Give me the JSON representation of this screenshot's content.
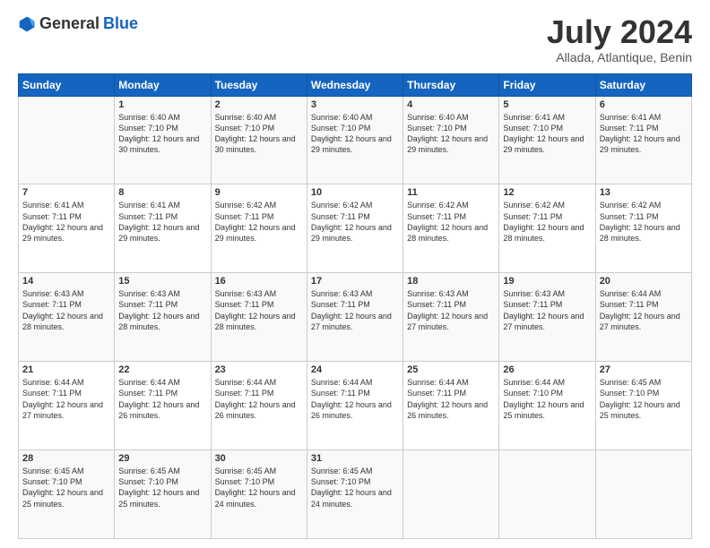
{
  "header": {
    "logo_general": "General",
    "logo_blue": "Blue",
    "month_year": "July 2024",
    "location": "Allada, Atlantique, Benin"
  },
  "weekdays": [
    "Sunday",
    "Monday",
    "Tuesday",
    "Wednesday",
    "Thursday",
    "Friday",
    "Saturday"
  ],
  "weeks": [
    [
      {
        "day": "",
        "sunrise": "",
        "sunset": "",
        "daylight": ""
      },
      {
        "day": "1",
        "sunrise": "Sunrise: 6:40 AM",
        "sunset": "Sunset: 7:10 PM",
        "daylight": "Daylight: 12 hours and 30 minutes."
      },
      {
        "day": "2",
        "sunrise": "Sunrise: 6:40 AM",
        "sunset": "Sunset: 7:10 PM",
        "daylight": "Daylight: 12 hours and 30 minutes."
      },
      {
        "day": "3",
        "sunrise": "Sunrise: 6:40 AM",
        "sunset": "Sunset: 7:10 PM",
        "daylight": "Daylight: 12 hours and 29 minutes."
      },
      {
        "day": "4",
        "sunrise": "Sunrise: 6:40 AM",
        "sunset": "Sunset: 7:10 PM",
        "daylight": "Daylight: 12 hours and 29 minutes."
      },
      {
        "day": "5",
        "sunrise": "Sunrise: 6:41 AM",
        "sunset": "Sunset: 7:10 PM",
        "daylight": "Daylight: 12 hours and 29 minutes."
      },
      {
        "day": "6",
        "sunrise": "Sunrise: 6:41 AM",
        "sunset": "Sunset: 7:11 PM",
        "daylight": "Daylight: 12 hours and 29 minutes."
      }
    ],
    [
      {
        "day": "7",
        "sunrise": "Sunrise: 6:41 AM",
        "sunset": "Sunset: 7:11 PM",
        "daylight": "Daylight: 12 hours and 29 minutes."
      },
      {
        "day": "8",
        "sunrise": "Sunrise: 6:41 AM",
        "sunset": "Sunset: 7:11 PM",
        "daylight": "Daylight: 12 hours and 29 minutes."
      },
      {
        "day": "9",
        "sunrise": "Sunrise: 6:42 AM",
        "sunset": "Sunset: 7:11 PM",
        "daylight": "Daylight: 12 hours and 29 minutes."
      },
      {
        "day": "10",
        "sunrise": "Sunrise: 6:42 AM",
        "sunset": "Sunset: 7:11 PM",
        "daylight": "Daylight: 12 hours and 29 minutes."
      },
      {
        "day": "11",
        "sunrise": "Sunrise: 6:42 AM",
        "sunset": "Sunset: 7:11 PM",
        "daylight": "Daylight: 12 hours and 28 minutes."
      },
      {
        "day": "12",
        "sunrise": "Sunrise: 6:42 AM",
        "sunset": "Sunset: 7:11 PM",
        "daylight": "Daylight: 12 hours and 28 minutes."
      },
      {
        "day": "13",
        "sunrise": "Sunrise: 6:42 AM",
        "sunset": "Sunset: 7:11 PM",
        "daylight": "Daylight: 12 hours and 28 minutes."
      }
    ],
    [
      {
        "day": "14",
        "sunrise": "Sunrise: 6:43 AM",
        "sunset": "Sunset: 7:11 PM",
        "daylight": "Daylight: 12 hours and 28 minutes."
      },
      {
        "day": "15",
        "sunrise": "Sunrise: 6:43 AM",
        "sunset": "Sunset: 7:11 PM",
        "daylight": "Daylight: 12 hours and 28 minutes."
      },
      {
        "day": "16",
        "sunrise": "Sunrise: 6:43 AM",
        "sunset": "Sunset: 7:11 PM",
        "daylight": "Daylight: 12 hours and 28 minutes."
      },
      {
        "day": "17",
        "sunrise": "Sunrise: 6:43 AM",
        "sunset": "Sunset: 7:11 PM",
        "daylight": "Daylight: 12 hours and 27 minutes."
      },
      {
        "day": "18",
        "sunrise": "Sunrise: 6:43 AM",
        "sunset": "Sunset: 7:11 PM",
        "daylight": "Daylight: 12 hours and 27 minutes."
      },
      {
        "day": "19",
        "sunrise": "Sunrise: 6:43 AM",
        "sunset": "Sunset: 7:11 PM",
        "daylight": "Daylight: 12 hours and 27 minutes."
      },
      {
        "day": "20",
        "sunrise": "Sunrise: 6:44 AM",
        "sunset": "Sunset: 7:11 PM",
        "daylight": "Daylight: 12 hours and 27 minutes."
      }
    ],
    [
      {
        "day": "21",
        "sunrise": "Sunrise: 6:44 AM",
        "sunset": "Sunset: 7:11 PM",
        "daylight": "Daylight: 12 hours and 27 minutes."
      },
      {
        "day": "22",
        "sunrise": "Sunrise: 6:44 AM",
        "sunset": "Sunset: 7:11 PM",
        "daylight": "Daylight: 12 hours and 26 minutes."
      },
      {
        "day": "23",
        "sunrise": "Sunrise: 6:44 AM",
        "sunset": "Sunset: 7:11 PM",
        "daylight": "Daylight: 12 hours and 26 minutes."
      },
      {
        "day": "24",
        "sunrise": "Sunrise: 6:44 AM",
        "sunset": "Sunset: 7:11 PM",
        "daylight": "Daylight: 12 hours and 26 minutes."
      },
      {
        "day": "25",
        "sunrise": "Sunrise: 6:44 AM",
        "sunset": "Sunset: 7:11 PM",
        "daylight": "Daylight: 12 hours and 26 minutes."
      },
      {
        "day": "26",
        "sunrise": "Sunrise: 6:44 AM",
        "sunset": "Sunset: 7:10 PM",
        "daylight": "Daylight: 12 hours and 25 minutes."
      },
      {
        "day": "27",
        "sunrise": "Sunrise: 6:45 AM",
        "sunset": "Sunset: 7:10 PM",
        "daylight": "Daylight: 12 hours and 25 minutes."
      }
    ],
    [
      {
        "day": "28",
        "sunrise": "Sunrise: 6:45 AM",
        "sunset": "Sunset: 7:10 PM",
        "daylight": "Daylight: 12 hours and 25 minutes."
      },
      {
        "day": "29",
        "sunrise": "Sunrise: 6:45 AM",
        "sunset": "Sunset: 7:10 PM",
        "daylight": "Daylight: 12 hours and 25 minutes."
      },
      {
        "day": "30",
        "sunrise": "Sunrise: 6:45 AM",
        "sunset": "Sunset: 7:10 PM",
        "daylight": "Daylight: 12 hours and 24 minutes."
      },
      {
        "day": "31",
        "sunrise": "Sunrise: 6:45 AM",
        "sunset": "Sunset: 7:10 PM",
        "daylight": "Daylight: 12 hours and 24 minutes."
      },
      {
        "day": "",
        "sunrise": "",
        "sunset": "",
        "daylight": ""
      },
      {
        "day": "",
        "sunrise": "",
        "sunset": "",
        "daylight": ""
      },
      {
        "day": "",
        "sunrise": "",
        "sunset": "",
        "daylight": ""
      }
    ]
  ]
}
